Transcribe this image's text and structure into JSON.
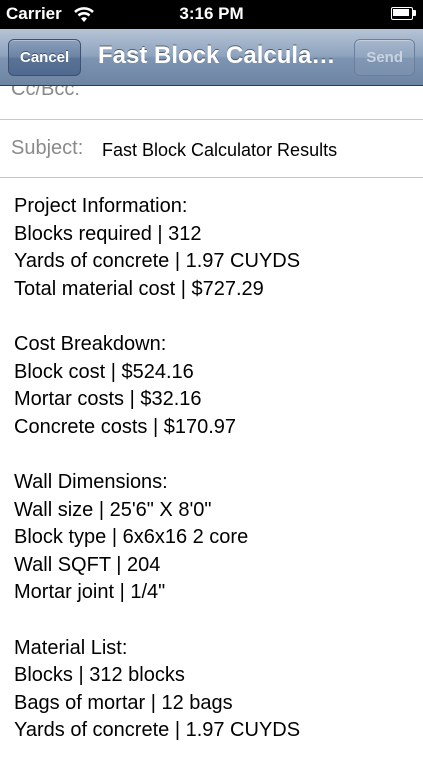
{
  "status_bar": {
    "carrier": "Carrier",
    "time": "3:16 PM",
    "wifi_icon": "wifi-icon",
    "battery_icon": "battery-icon"
  },
  "nav": {
    "cancel_label": "Cancel",
    "title": "Fast Block Calculator",
    "send_label": "Send"
  },
  "fields": {
    "cc_bcc_label": "Cc/Bcc:",
    "subject_label": "Subject:",
    "subject_value": "Fast Block Calculator Results"
  },
  "body": {
    "sections": [
      {
        "heading": "Project Information:",
        "lines": [
          "Blocks required | 312",
          "Yards of concrete | 1.97 CUYDS",
          "Total material cost | $727.29"
        ]
      },
      {
        "heading": "Cost Breakdown:",
        "lines": [
          "Block cost | $524.16",
          "Mortar costs | $32.16",
          "Concrete costs | $170.97"
        ]
      },
      {
        "heading": "Wall Dimensions:",
        "lines": [
          "Wall size | 25'6\" X 8'0\"",
          "Block type | 6x6x16 2 core",
          "Wall SQFT | 204",
          "Mortar joint | 1/4\""
        ]
      },
      {
        "heading": "Material List:",
        "lines": [
          "Blocks | 312 blocks",
          "Bags of mortar | 12 bags",
          "Yards of concrete | 1.97 CUYDS"
        ]
      }
    ]
  },
  "colors": {
    "nav_bar": "#8ea3be",
    "status_bar": "#000000",
    "label_gray": "#8a8a8a"
  }
}
